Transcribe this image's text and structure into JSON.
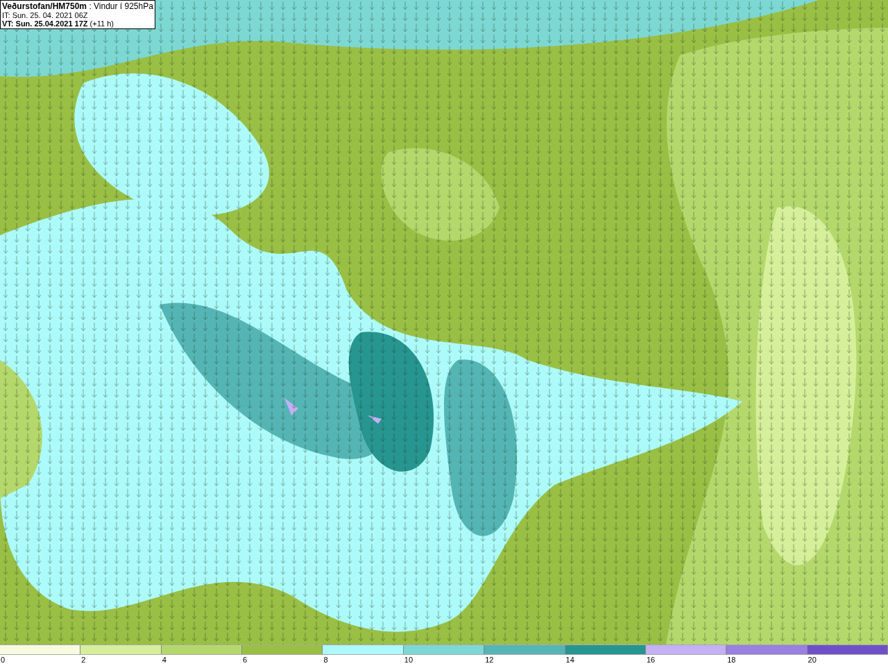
{
  "header": {
    "title_line": "**Veðurstofan/HM750m** : Vindur í 925hPa",
    "issue_time": "IT: Sun. 25. 04. 2021 06Z",
    "valid_line": "**VT: Sun. 25.04.2021 17Z** (+11 h)"
  },
  "legend": {
    "bins": [
      {
        "label": "0",
        "color": "#f7fbe0"
      },
      {
        "label": "2",
        "color": "#d5ef9a"
      },
      {
        "label": "4",
        "color": "#b5d86c"
      },
      {
        "label": "6",
        "color": "#9abf45"
      },
      {
        "label": "8",
        "color": "#adfafa"
      },
      {
        "label": "10",
        "color": "#7dd8d4"
      },
      {
        "label": "12",
        "color": "#55b5b5"
      },
      {
        "label": "14",
        "color": "#279590"
      },
      {
        "label": "16",
        "color": "#c3b0f5"
      },
      {
        "label": "18",
        "color": "#9a80e0"
      },
      {
        "label": "20",
        "color": "#7050c8"
      }
    ]
  }
}
